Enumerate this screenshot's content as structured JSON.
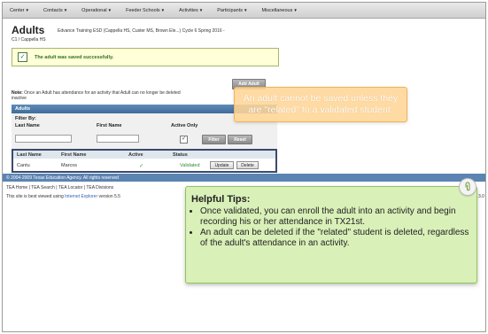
{
  "nav": {
    "items": [
      "Center",
      "Contacts",
      "Operational",
      "Feeder Schools",
      "Activities",
      "Participants",
      "Miscellaneous"
    ]
  },
  "header": {
    "title": "Adults",
    "subtitle": "Edvance Training ESD (Cappella HS, Custer MS, Brown Ele...) Cycle 6  Spring 2016 -",
    "subtitle2": "C1 / Cappella HS"
  },
  "success_message": "The adult was saved successfully.",
  "add_button": "Add Adult",
  "note": {
    "label": "Note:",
    "text": "Once an Adult has attendance for an activity that Adult can no longer be deleted",
    "text2": "inactive"
  },
  "panel": {
    "title": "Adults",
    "filter_by": "Filter By:",
    "last_name_label": "Last Name",
    "first_name_label": "First Name",
    "active_only_label": "Active Only",
    "filter_button": "Filter",
    "reset_button": "Reset"
  },
  "table": {
    "columns": [
      "Last Name",
      "First Name",
      "Active",
      "Status"
    ],
    "rows": [
      {
        "last": "Cantu",
        "first": "Marcos",
        "active": "✓",
        "status": "Validated",
        "update": "Update",
        "delete": "Delete"
      }
    ]
  },
  "footer": {
    "copyright": "© 2004-2009 Texas Education Agency. All rights reserved",
    "links": "TEA Home | TEA Search | TEA Locator | TEA Divisions",
    "note_prefix": "This site is best viewed using ",
    "note_link": "Internet Explorer",
    "note_suffix": " version 5.5",
    "right_fragment": "3.0"
  },
  "callout_warning": "An adult cannot be saved unless they are \"related\" to a validated student.",
  "tips": {
    "title": "Helpful Tips:",
    "items": [
      "Once validated, you can enroll the adult into an activity and begin recording his or her attendance in TX21st.",
      "An adult can be deleted if the \"related\" student is deleted, regardless of the adult's attendance in an activity."
    ]
  },
  "colors": {
    "success_green": "#2e6f1e",
    "panel_blue": "#3f6c9c",
    "callout_orange": "#ffd696",
    "callout_green": "#d9f0b8"
  }
}
